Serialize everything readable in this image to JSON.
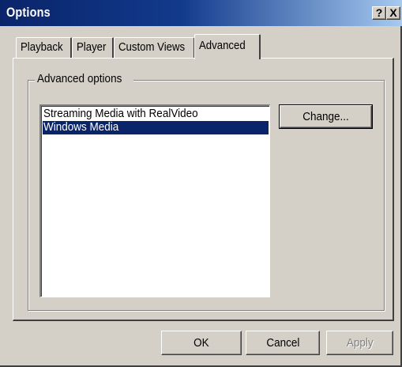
{
  "window": {
    "title": "Options",
    "help_glyph": "?",
    "close_glyph": "X"
  },
  "tabs": [
    {
      "label": "Playback",
      "active": false
    },
    {
      "label": "Player",
      "active": false
    },
    {
      "label": "Custom Views",
      "active": false
    },
    {
      "label": "Advanced",
      "active": true
    }
  ],
  "advanced": {
    "group_label": "Advanced options",
    "list_items": [
      {
        "label": "Streaming Media with RealVideo",
        "selected": false
      },
      {
        "label": "Windows Media",
        "selected": true
      }
    ],
    "change_button": "Change..."
  },
  "footer": {
    "ok_label": "OK",
    "cancel_label": "Cancel",
    "apply_label": "Apply",
    "apply_enabled": false
  },
  "colors": {
    "title_bar_start": "#0a246a",
    "title_bar_end": "#a6caf0",
    "face": "#d4d0c8",
    "selection": "#0a246a"
  }
}
